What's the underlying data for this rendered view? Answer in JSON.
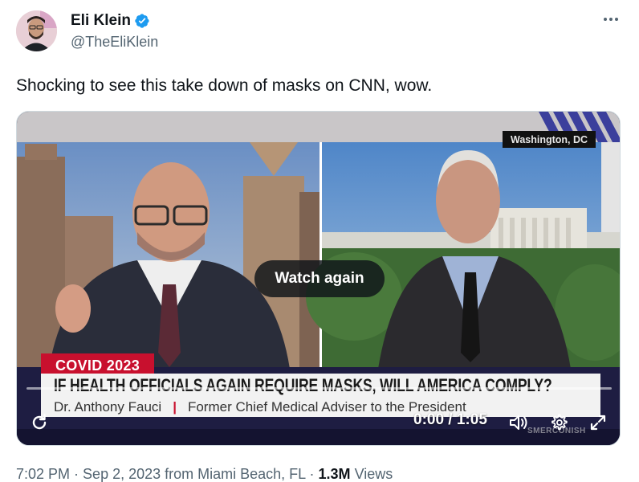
{
  "author": {
    "name": "Eli Klein",
    "handle": "@TheEliKlein",
    "verified_icon": "verified-badge-icon"
  },
  "tweet": {
    "text": "Shocking to see this take down of masks on CNN, wow."
  },
  "video": {
    "overlay_button": "Watch again",
    "location_tag": "Washington, DC",
    "topic_tag": "COVID 2023",
    "headline": "IF HEALTH OFFICIALS AGAIN REQUIRE MASKS, WILL AMERICA COMPLY?",
    "guest_name": "Dr. Anthony Fauci",
    "guest_separator": "|",
    "guest_title": "Former Chief Medical Adviser to the President",
    "time": "0:00 / 1:05",
    "progress": 0,
    "watermark": "SMERCONISH",
    "colors": {
      "cnn_red": "#c8102e",
      "banner": "#f2f2f2"
    }
  },
  "meta": {
    "time": "7:02 PM",
    "sep1": " · ",
    "date": "Sep 2, 2023",
    "location": " from Miami Beach, FL",
    "sep2": " · ",
    "views_count": "1.3M",
    "views_label": " Views"
  },
  "icons": [
    "more-icon",
    "replay-icon",
    "volume-icon",
    "settings-icon",
    "fullscreen-icon"
  ]
}
